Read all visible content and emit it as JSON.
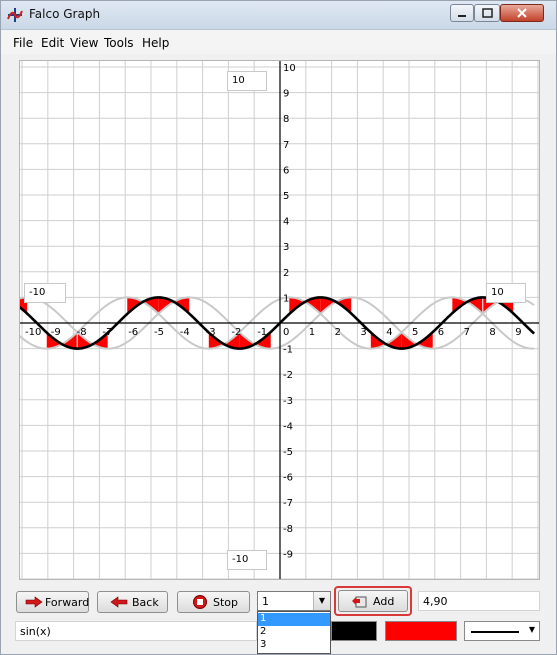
{
  "window": {
    "title": "Falco Graph"
  },
  "menu": [
    "File",
    "Edit",
    "View",
    "Tools",
    "Help"
  ],
  "graph": {
    "x_ticks": [
      "-10",
      "-9",
      "-8",
      "-7",
      "-6",
      "-5",
      "-4",
      "-3",
      "-2",
      "-1",
      "0",
      "1",
      "2",
      "3",
      "4",
      "5",
      "6",
      "7",
      "8",
      "9"
    ],
    "y_ticks": [
      "10",
      "9",
      "8",
      "7",
      "6",
      "5",
      "4",
      "3",
      "2",
      "1",
      "-1",
      "-2",
      "-3",
      "-4",
      "-5",
      "-6",
      "-7",
      "-8",
      "-9"
    ],
    "range": {
      "y_max": "10",
      "y_min": "-10",
      "x_min": "-10",
      "x_max": "10"
    },
    "xlim": [
      -10,
      10
    ],
    "ylim": [
      -10,
      10
    ],
    "series": [
      {
        "expr": "sin(x)",
        "color": "#000000",
        "fill": "#ff0000"
      }
    ],
    "ghost_color": "#c9c9c9"
  },
  "toolbar": {
    "forward_label": "Forward",
    "back_label": "Back",
    "stop_label": "Stop",
    "select_value": "1",
    "add_label": "Add",
    "coord_value": "4,90",
    "options": [
      "1",
      "2",
      "3"
    ]
  },
  "bottom": {
    "expression": "sin(x)",
    "line_color": "#000000",
    "fill_color": "#ff0000"
  }
}
